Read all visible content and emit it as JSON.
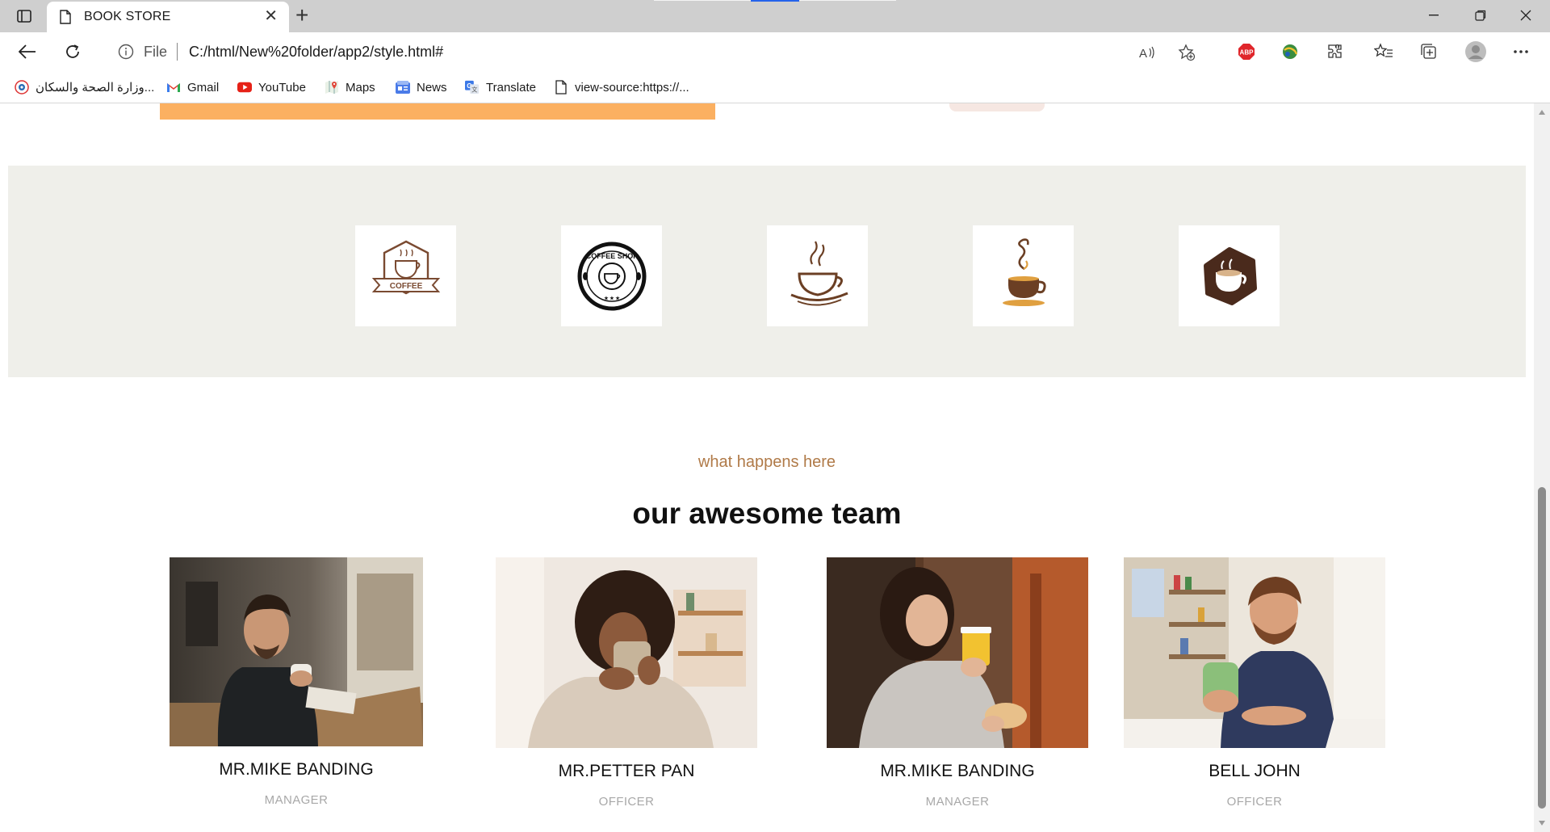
{
  "browser": {
    "tab_title": "BOOK STORE",
    "address_scheme": "File",
    "address_url": "C:/html/New%20folder/app2/style.html#"
  },
  "bookmarks": [
    {
      "label": "وزارة الصحة والسكان...",
      "icon": "ministry-logo-icon"
    },
    {
      "label": "Gmail",
      "icon": "gmail-icon"
    },
    {
      "label": "YouTube",
      "icon": "youtube-icon"
    },
    {
      "label": "Maps",
      "icon": "maps-icon"
    },
    {
      "label": "News",
      "icon": "news-icon"
    },
    {
      "label": "Translate",
      "icon": "translate-icon"
    },
    {
      "label": "view-source:https://...",
      "icon": "page-icon"
    }
  ],
  "colors": {
    "accent_orange": "#fbb061",
    "band_bg": "#efefea",
    "kicker_color": "#b07a48",
    "coffee_brown": "#6b3f24"
  },
  "logos": [
    {
      "name": "coffee-ribbon-badge",
      "text": "COFFEE"
    },
    {
      "name": "coffee-shop-circle-badge",
      "text": "COFFEE SHOP"
    },
    {
      "name": "steaming-cup-logo"
    },
    {
      "name": "aroma-cup-logo"
    },
    {
      "name": "hexagon-cup-logo"
    }
  ],
  "team_section": {
    "kicker": "what happens here",
    "title": "our awesome team",
    "members": [
      {
        "name": "MR.MIKE BANDING",
        "role": "MANAGER"
      },
      {
        "name": "MR.PETTER PAN",
        "role": "OFFICER"
      },
      {
        "name": "MR.MIKE BANDING",
        "role": "MANAGER"
      },
      {
        "name": "BELL JOHN",
        "role": "OFFICER"
      }
    ]
  }
}
